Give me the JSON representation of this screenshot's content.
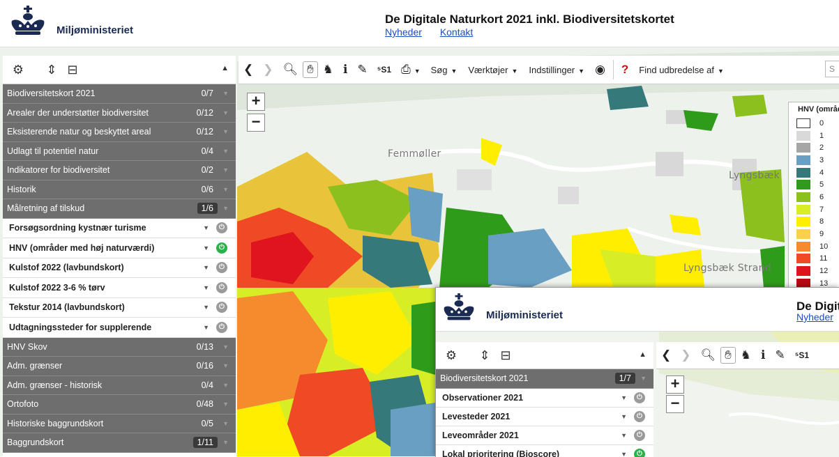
{
  "window1": {
    "header": {
      "ministry": "Miljøministeriet",
      "title": "De Digitale Naturkort 2021 inkl. Biodiversitetskortet",
      "links": [
        "Nyheder",
        "Kontakt"
      ]
    },
    "toolbar": {
      "menus": [
        "Søg",
        "Værktøjer",
        "Indstillinger",
        "Find udbredelse af"
      ],
      "search_partial": "S"
    },
    "categories_top": [
      {
        "label": "Biodiversitetskort 2021",
        "count": "0/7"
      },
      {
        "label": "Arealer der understøtter biodiversitet",
        "count": "0/12"
      },
      {
        "label": "Eksisterende natur og beskyttet areal",
        "count": "0/12"
      },
      {
        "label": "Udlagt til potentiel natur",
        "count": "0/4"
      },
      {
        "label": "Indikatorer for biodiversitet",
        "count": "0/2"
      },
      {
        "label": "Historik",
        "count": "0/6"
      },
      {
        "label": "Målretning af tilskud",
        "count": "1/6"
      }
    ],
    "layers": [
      {
        "label": "Forsøgsordning kystnær turisme",
        "on": false
      },
      {
        "label": "HNV (områder med høj naturværdi)",
        "on": true
      },
      {
        "label": "Kulstof 2022 (lavbundskort)",
        "on": false
      },
      {
        "label": "Kulstof 2022 3-6 % tørv",
        "on": false
      },
      {
        "label": "Tekstur 2014 (lavbundskort)",
        "on": false
      },
      {
        "label": "Udtagningssteder for supplerende",
        "on": false
      }
    ],
    "categories_bottom": [
      {
        "label": "HNV Skov",
        "count": "0/13"
      },
      {
        "label": "Adm. grænser",
        "count": "0/16"
      },
      {
        "label": "Adm. grænser - historisk",
        "count": "0/4"
      },
      {
        "label": "Ortofoto",
        "count": "0/48"
      },
      {
        "label": "Historiske baggrundskort",
        "count": "0/5"
      },
      {
        "label": "Baggrundskort",
        "count": "1/11"
      }
    ],
    "map_labels": [
      "Femmøller",
      "Lyngsbæk",
      "Lyngsbæk Strand"
    ],
    "legend": {
      "title": "HNV (områder",
      "items": [
        {
          "label": "0",
          "color": "#ffffff"
        },
        {
          "label": "1",
          "color": "#d9d9d9"
        },
        {
          "label": "2",
          "color": "#a6a6a6"
        },
        {
          "label": "3",
          "color": "#6a9fc4"
        },
        {
          "label": "4",
          "color": "#35797a"
        },
        {
          "label": "5",
          "color": "#2f9b1a"
        },
        {
          "label": "6",
          "color": "#8bc01f"
        },
        {
          "label": "7",
          "color": "#d7ee27"
        },
        {
          "label": "8",
          "color": "#ffee00"
        },
        {
          "label": "9",
          "color": "#fbd04a"
        },
        {
          "label": "10",
          "color": "#f58b2d"
        },
        {
          "label": "11",
          "color": "#ef4a25"
        },
        {
          "label": "12",
          "color": "#e0141e"
        },
        {
          "label": "13",
          "color": "#b80a14"
        }
      ]
    }
  },
  "window2": {
    "header": {
      "ministry": "Miljøministeriet",
      "title": "De Digit",
      "links": [
        "Nyheder"
      ]
    },
    "categories": [
      {
        "label": "Biodiversitetskort 2021",
        "count": "1/7"
      }
    ],
    "layers": [
      {
        "label": "Observationer 2021",
        "on": false
      },
      {
        "label": "Levesteder 2021",
        "on": false
      },
      {
        "label": "Leveområder 2021",
        "on": false
      },
      {
        "label": "Lokal prioritering (Bioscore)",
        "on": true
      }
    ]
  }
}
